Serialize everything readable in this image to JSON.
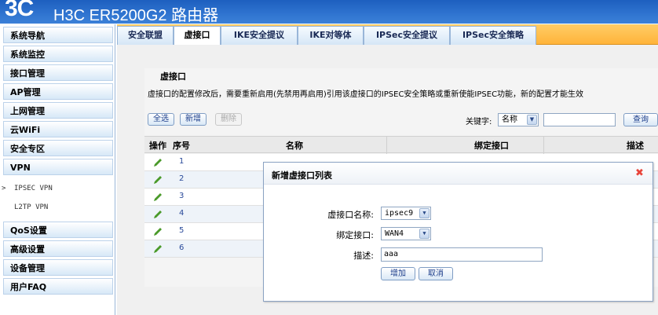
{
  "header": {
    "logo": "3C",
    "title": "H3C ER5200G2 路由器"
  },
  "sidebar": {
    "items": [
      {
        "label": "系统导航"
      },
      {
        "label": "系统监控"
      },
      {
        "label": "接口管理"
      },
      {
        "label": "AP管理"
      },
      {
        "label": "上网管理"
      },
      {
        "label": "云WiFi"
      },
      {
        "label": "安全专区"
      },
      {
        "label": "VPN"
      }
    ],
    "vpn_sub": [
      {
        "label": "IPSEC VPN",
        "selected": true
      },
      {
        "label": "L2TP VPN",
        "selected": false
      }
    ],
    "items_after": [
      {
        "label": "QoS设置"
      },
      {
        "label": "高级设置"
      },
      {
        "label": "设备管理"
      },
      {
        "label": "用户FAQ"
      }
    ]
  },
  "tabs": [
    {
      "label": "安全联盟",
      "active": false
    },
    {
      "label": "虚接口",
      "active": true
    },
    {
      "label": "IKE安全提议",
      "active": false
    },
    {
      "label": "IKE对等体",
      "active": false
    },
    {
      "label": "IPSec安全提议",
      "active": false
    },
    {
      "label": "IPSec安全策略",
      "active": false
    }
  ],
  "panel": {
    "title": "虚接口",
    "notice": "虚接口的配置修改后，需要重新启用(先禁用再启用)引用该虚接口的IPSEC安全策略或重新使能IPSEC功能，新的配置才能生效",
    "select_all": "全选",
    "add": "新增",
    "delete": "删除",
    "keyword_label": "关键字:",
    "keyword_field": "名称",
    "query": "查询"
  },
  "table": {
    "headers": {
      "op": "操作",
      "seq": "序号",
      "name": "名称",
      "bind": "绑定接口",
      "desc": "描述"
    },
    "rows": [
      {
        "seq": "1"
      },
      {
        "seq": "2"
      },
      {
        "seq": "3"
      },
      {
        "seq": "4"
      },
      {
        "seq": "5"
      },
      {
        "seq": "6"
      }
    ]
  },
  "modal": {
    "title": "新增虚接口列表",
    "name_label": "虚接口名称:",
    "name_value": "ipsec9",
    "bind_label": "绑定接口:",
    "bind_value": "WAN4",
    "desc_label": "描述:",
    "desc_value": "aaa",
    "add_button": "增加",
    "cancel_button": "取消"
  },
  "colors": {
    "header": "#2f74d0",
    "tab_bar": "#ffb43a",
    "close": "#e8443a",
    "pencil": "#4a9a2a"
  }
}
